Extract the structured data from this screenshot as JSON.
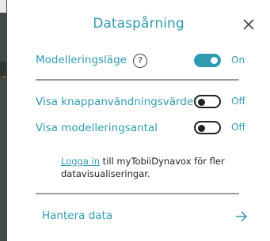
{
  "dialog": {
    "title": "Dataspårning",
    "close_icon": "close-icon"
  },
  "settings": [
    {
      "label": "Modelleringsläge",
      "state": "On",
      "enabled": true,
      "help_icon": "help-icon"
    },
    {
      "label": "Visa knappanvändningsvärdet",
      "state": "Off",
      "enabled": false
    },
    {
      "label": "Visa modelleringsantal",
      "state": "Off",
      "enabled": false
    }
  ],
  "info": {
    "link": "Logga in",
    "text": " till myTobiiDynavox för fler datavisualiseringar."
  },
  "manage": {
    "label": "Hantera data",
    "icon": "arrow-right-icon"
  },
  "colors": {
    "accent": "#2f9bb0",
    "toggle_off_border": "#222222",
    "divider": "#9a9a9a"
  }
}
